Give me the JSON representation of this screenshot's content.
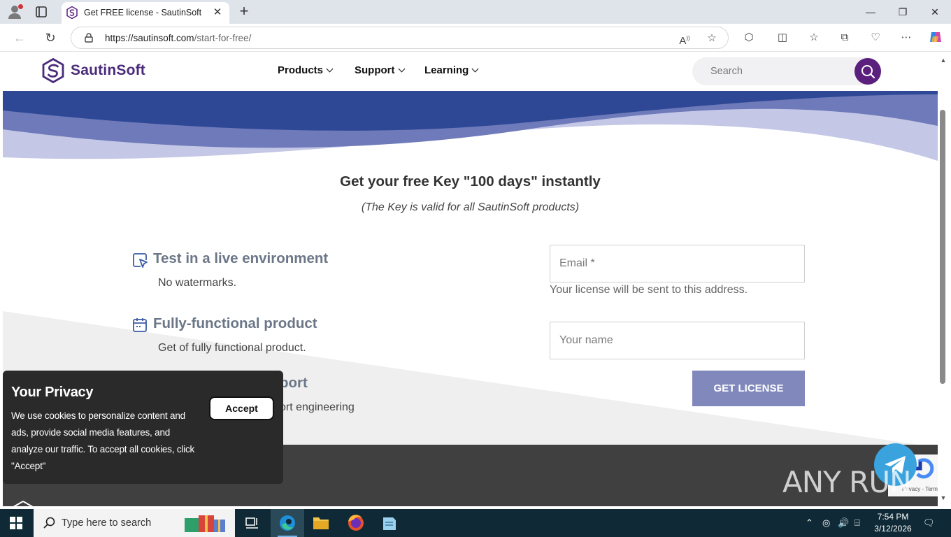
{
  "browser": {
    "tab_title": "Get FREE license - SautinSoft",
    "url_host": "https://sautinsoft.com",
    "url_path": "/start-for-free/"
  },
  "site": {
    "logo_text": "SautinSoft",
    "nav": [
      {
        "label": "Products"
      },
      {
        "label": "Support"
      },
      {
        "label": "Learning"
      }
    ],
    "search_placeholder": "Search"
  },
  "main": {
    "title": "Get your free Key \"100 days\" instantly",
    "subtitle": "(The Key is valid for all SautinSoft products)",
    "features": [
      {
        "heading": "Test in a live environment",
        "text": "No watermarks.",
        "icon": "cursor-square-icon"
      },
      {
        "heading": "Fully-functional product",
        "text": "Get of fully functional product.",
        "icon": "calendar-icon"
      },
      {
        "heading": "port",
        "text": "ort engineering",
        "icon": "support-icon"
      }
    ]
  },
  "form": {
    "email_placeholder": "Email *",
    "email_hint": "Your license will be sent to this address.",
    "name_placeholder": "Your name",
    "submit_label": "GET LICENSE"
  },
  "privacy": {
    "title": "Your Privacy",
    "text": "We use cookies to personalize content and ads, provide social media features, and analyze our traffic. To accept all cookies, click \"Accept\"",
    "accept_label": "Accept"
  },
  "recaptcha": {
    "links": "Privacy - Terms"
  },
  "watermark": {
    "text": "ANY RUN"
  },
  "taskbar": {
    "search_placeholder": "Type here to search",
    "time": "7:54 PM",
    "date": "3/12/2026"
  },
  "colors": {
    "brand_purple": "#5b1f7e",
    "button": "#8088bc",
    "wave_dark": "#2f4896",
    "wave_light": "#c4c7e6",
    "footer": "#404040"
  }
}
